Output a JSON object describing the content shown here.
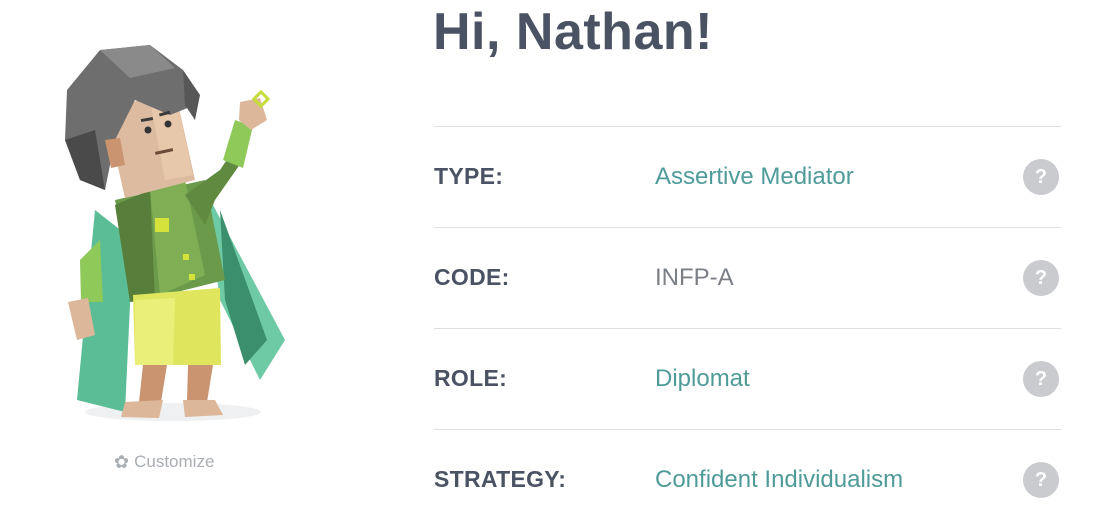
{
  "greeting": "Hi, Nathan!",
  "avatar": {
    "icon": "character-avatar"
  },
  "customize": {
    "label": "Customize",
    "icon": "gear-icon"
  },
  "profile": [
    {
      "label": "TYPE:",
      "value": "Assertive Mediator",
      "help": "?"
    },
    {
      "label": "CODE:",
      "value": "INFP-A",
      "help": "?"
    },
    {
      "label": "ROLE:",
      "value": "Diplomat",
      "help": "?"
    },
    {
      "label": "STRATEGY:",
      "value": "Confident Individualism",
      "help": "?"
    }
  ],
  "colors": {
    "heading": "#4a5264",
    "accent_value": "#4f9b9a",
    "plain_value": "#7a7f86",
    "help_bg": "#c9cbce",
    "divider": "#dddfe2"
  }
}
